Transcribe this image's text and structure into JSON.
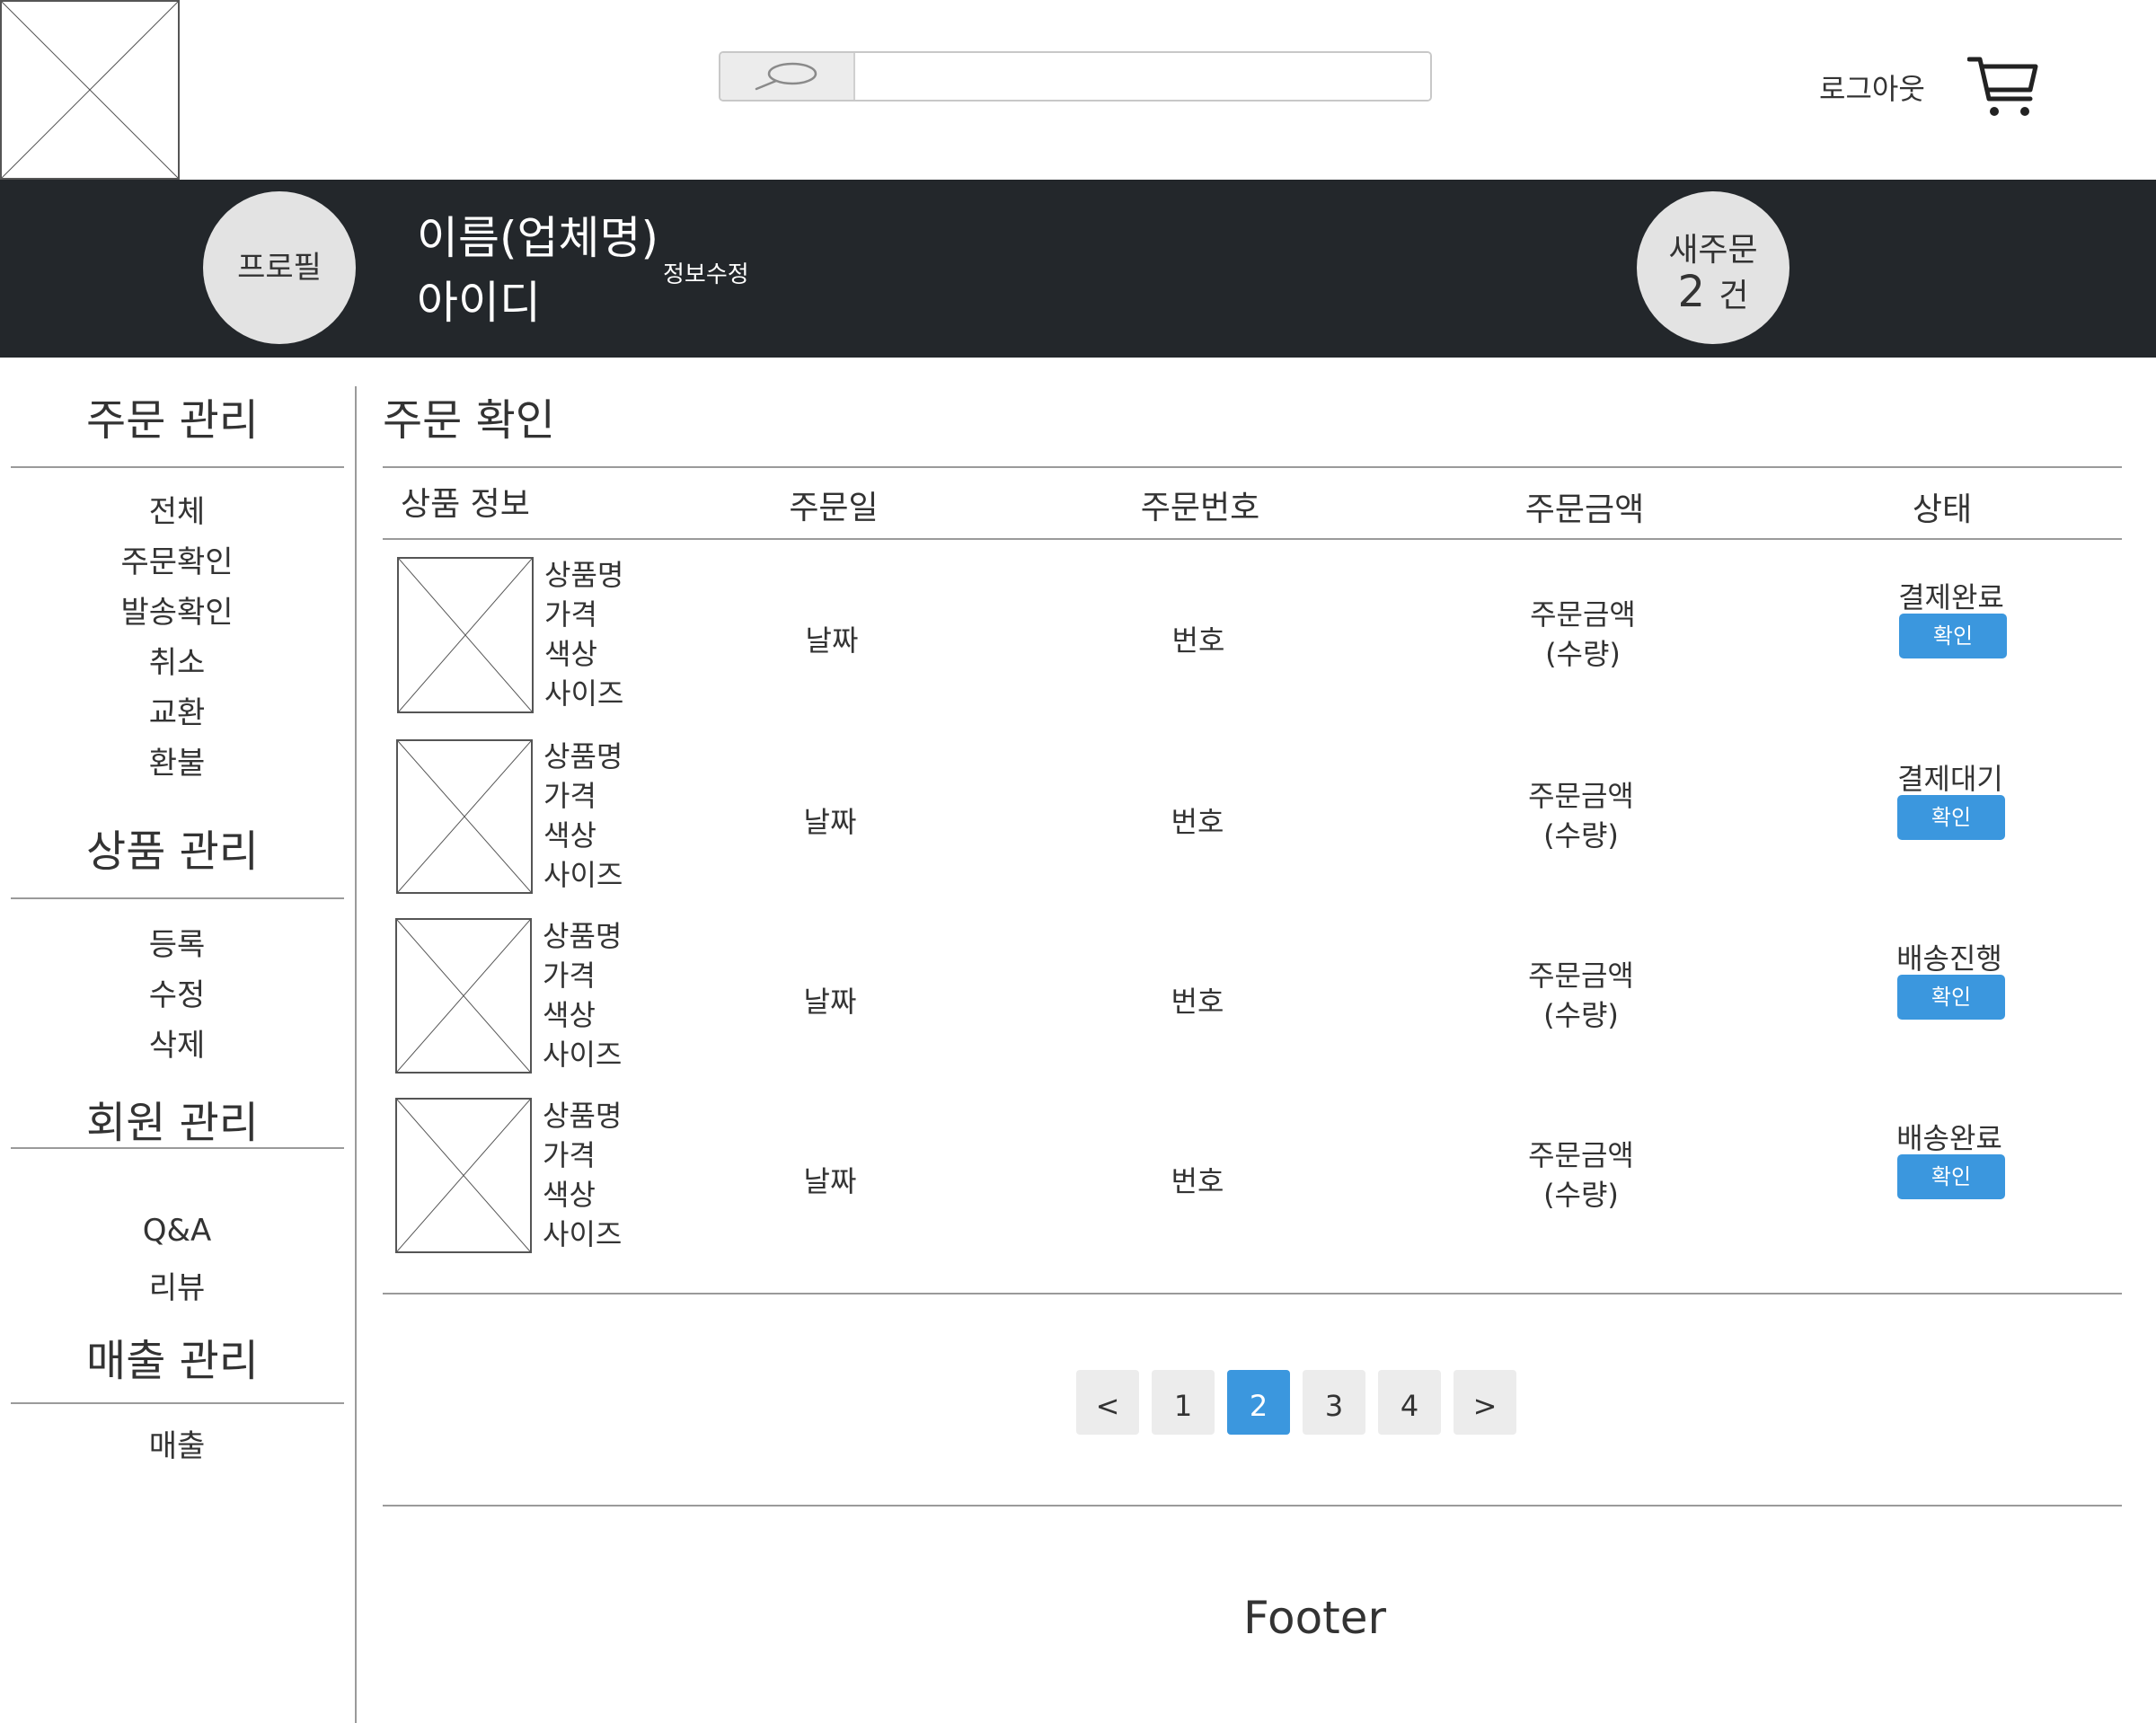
{
  "header": {
    "search": {
      "placeholder": "",
      "value": ""
    },
    "logout_label": "로그아웃"
  },
  "profile": {
    "avatar_label": "프로필",
    "name": "이름(업체명)",
    "user_id": "아이디",
    "edit_label": "정보수정",
    "new_orders": {
      "label": "새주문",
      "count": "2",
      "unit": "건"
    }
  },
  "sidebar": {
    "sections": [
      {
        "title": "주문 관리",
        "items": [
          "전체",
          "주문확인",
          "발송확인",
          "취소",
          "교환",
          "환불"
        ]
      },
      {
        "title": "상품 관리",
        "items": [
          "등록",
          "수정",
          "삭제"
        ]
      },
      {
        "title": "회원 관리",
        "items": [
          "Q&A",
          "리뷰"
        ]
      },
      {
        "title": "매출 관리",
        "items": [
          "매출"
        ]
      }
    ]
  },
  "main": {
    "title": "주문 확인",
    "columns": [
      "상품 정보",
      "주문일",
      "주문번호",
      "주문금액",
      "상태"
    ],
    "rows": [
      {
        "info": [
          "상품명",
          "가격",
          "색상",
          "사이즈"
        ],
        "date": "날짜",
        "number": "번호",
        "amount": [
          "주문금액",
          "(수량)"
        ],
        "status": "결제완료",
        "button": "확인"
      },
      {
        "info": [
          "상품명",
          "가격",
          "색상",
          "사이즈"
        ],
        "date": "날짜",
        "number": "번호",
        "amount": [
          "주문금액",
          "(수량)"
        ],
        "status": "결제대기",
        "button": "확인"
      },
      {
        "info": [
          "상품명",
          "가격",
          "색상",
          "사이즈"
        ],
        "date": "날짜",
        "number": "번호",
        "amount": [
          "주문금액",
          "(수량)"
        ],
        "status": "배송진행",
        "button": "확인"
      },
      {
        "info": [
          "상품명",
          "가격",
          "색상",
          "사이즈"
        ],
        "date": "날짜",
        "number": "번호",
        "amount": [
          "주문금액",
          "(수량)"
        ],
        "status": "배송완료",
        "button": "확인"
      }
    ],
    "pagination": {
      "prev": "<",
      "pages": [
        "1",
        "2",
        "3",
        "4"
      ],
      "current": "2",
      "next": ">"
    }
  },
  "footer": {
    "label": "Footer"
  },
  "colors": {
    "band": "#23272b",
    "accent": "#3b97de",
    "circle": "#e3e3e3"
  },
  "icons": {
    "logo": "image-placeholder",
    "search": "search-icon",
    "cart": "cart-icon"
  }
}
